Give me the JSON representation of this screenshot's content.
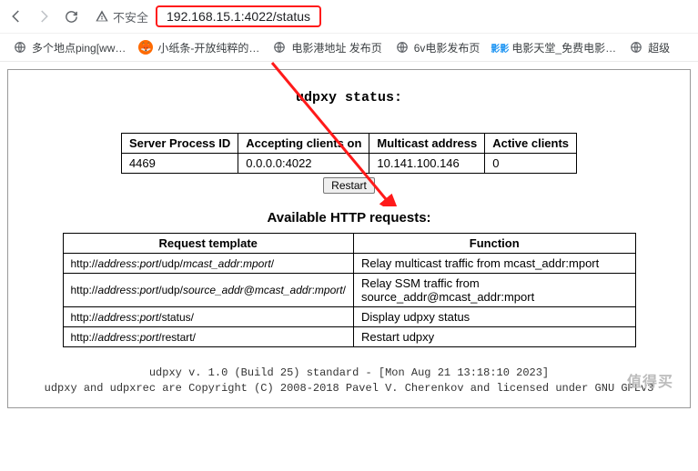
{
  "nav": {
    "insecure_label": "不安全",
    "url": "192.168.15.1:4022/status"
  },
  "bookmarks": [
    {
      "label": "多个地点ping[ww…",
      "icon": "globe",
      "color": "#5f6368"
    },
    {
      "label": "小纸条-开放纯粹的…",
      "icon": "fox",
      "color": "#ff6a00"
    },
    {
      "label": "电影港地址 发布页",
      "icon": "globe",
      "color": "#5f6368"
    },
    {
      "label": "6v电影发布页",
      "icon": "globe",
      "color": "#5f6368"
    },
    {
      "label": "电影天堂_免费电影…",
      "icon": "tv",
      "color": "#2196f3"
    },
    {
      "label": "超级",
      "icon": "globe",
      "color": "#5f6368"
    }
  ],
  "page": {
    "status_title": "udpxy status:",
    "table1": {
      "headers": [
        "Server Process ID",
        "Accepting clients on",
        "Multicast address",
        "Active clients"
      ],
      "row": [
        "4469",
        "0.0.0.0:4022",
        "10.141.100.146",
        "0"
      ]
    },
    "restart_label": "Restart",
    "http_title": "Available HTTP requests:",
    "table2": {
      "headers": [
        "Request template",
        "Function"
      ],
      "rows": [
        {
          "tpl": [
            "http://",
            "address",
            ":",
            "port",
            "/udp/",
            "mcast_addr",
            ":",
            "mport",
            "/"
          ],
          "fn": "Relay multicast traffic from mcast_addr:mport"
        },
        {
          "tpl": [
            "http://",
            "address",
            ":",
            "port",
            "/udp/",
            "source_addr",
            "@",
            "mcast_addr",
            ":",
            "mport",
            "/"
          ],
          "fn": "Relay SSM traffic from source_addr@mcast_addr:mport"
        },
        {
          "tpl": [
            "http://",
            "address",
            ":",
            "port",
            "/status/"
          ],
          "fn": "Display udpxy status"
        },
        {
          "tpl": [
            "http://",
            "address",
            ":",
            "port",
            "/restart/"
          ],
          "fn": "Restart udpxy"
        }
      ]
    },
    "footer1": "udpxy v. 1.0 (Build 25) standard - [Mon Aug 21 13:18:10 2023]",
    "footer2": "udpxy and udpxrec are Copyright (C) 2008-2018 Pavel V. Cherenkov and licensed under GNU GPLv3"
  },
  "watermark": "值得买"
}
